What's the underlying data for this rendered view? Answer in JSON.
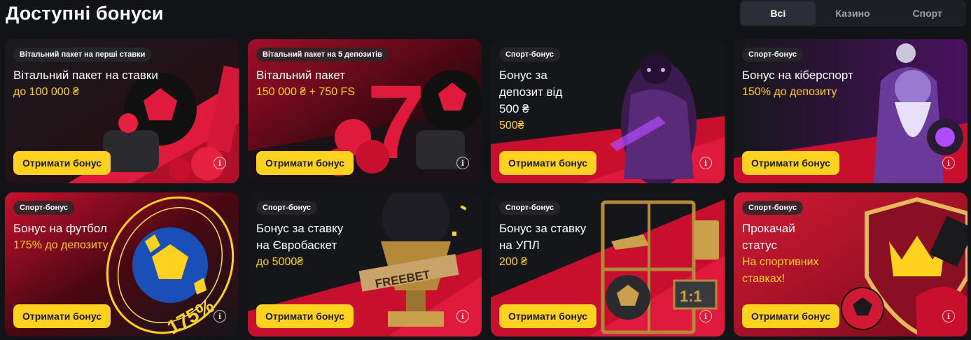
{
  "page": {
    "title": "Доступні бонуси"
  },
  "filters": {
    "tabs": [
      "Всі",
      "Казино",
      "Спорт"
    ],
    "active": "Всі"
  },
  "cards": [
    {
      "badge": "Вітальний пакет на перші ставки",
      "title": "Вітальний пакет на ставки",
      "amount": "до 100 000 ₴",
      "button": "Отримати бонус",
      "info": "i"
    },
    {
      "badge": "Вітальний пакет на 5 депозитів",
      "title": "Вітальний пакет",
      "amount": "150 000 ₴ + 750 FS",
      "button": "Отримати бонус",
      "info": "i"
    },
    {
      "badge": "Спорт-бонус",
      "title": "Бонус за депозит від 500 ₴",
      "amount": "500₴",
      "button": "Отримати бонус",
      "info": "i"
    },
    {
      "badge": "Спорт-бонус",
      "title": "Бонус на кіберспорт",
      "amount": "150% до депозиту",
      "button": "Отримати бонус",
      "info": "i"
    },
    {
      "badge": "Спорт-бонус",
      "title": "Бонус на футбол",
      "amount": "175% до депозиту",
      "button": "Отримати бонус",
      "info": "i"
    },
    {
      "badge": "Спорт-бонус",
      "title": "Бонус за ставку на Євробаскет",
      "amount": "до 5000₴",
      "button": "Отримати бонус",
      "info": "i"
    },
    {
      "badge": "Спорт-бонус",
      "title": "Бонус за ставку на УПЛ",
      "amount": "200 ₴",
      "button": "Отримати бонус",
      "info": "i"
    },
    {
      "badge": "Спорт-бонус",
      "title": "Прокачай статус",
      "amount": "На спортивних ставках!",
      "button": "Отримати бонус",
      "info": "i"
    }
  ],
  "art_labels": {
    "freebet": "FREEBET",
    "percent": "175%",
    "score": "1:1"
  },
  "colors": {
    "accent": "#ffd21f",
    "brand_red": "#e01a3c",
    "background": "#121316"
  }
}
